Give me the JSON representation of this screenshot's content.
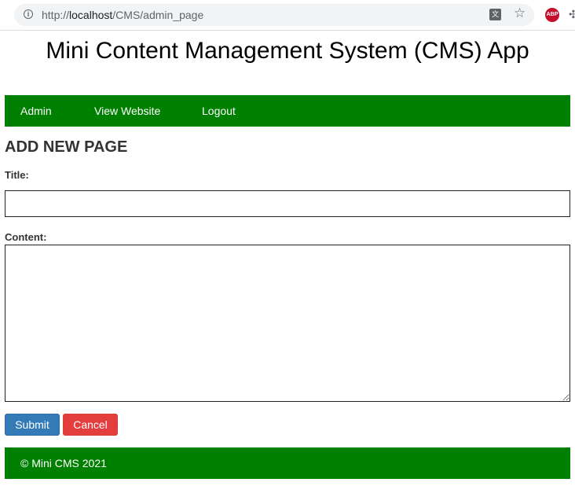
{
  "browser": {
    "url_prefix": "http://",
    "url_host": "localhost",
    "url_path": "/CMS/admin_page",
    "info_icon": "info-icon",
    "translate_icon": "translate-icon",
    "bookmark_icon": "star-icon",
    "extension_abp": "ABP",
    "puzzle_icon": "extensions-icon"
  },
  "header": {
    "title": "Mini Content Management System (CMS) App"
  },
  "nav": {
    "items": [
      {
        "label": "Admin"
      },
      {
        "label": "View Website"
      },
      {
        "label": "Logout"
      }
    ]
  },
  "form": {
    "heading": "ADD NEW PAGE",
    "title_label": "Title:",
    "title_value": "",
    "content_label": "Content:",
    "content_value": "",
    "submit_label": "Submit",
    "cancel_label": "Cancel"
  },
  "footer": {
    "text": "© Mini CMS 2021"
  },
  "colors": {
    "nav_bg": "#008000",
    "submit_bg": "#337ab7",
    "cancel_bg": "#e33d3d"
  }
}
